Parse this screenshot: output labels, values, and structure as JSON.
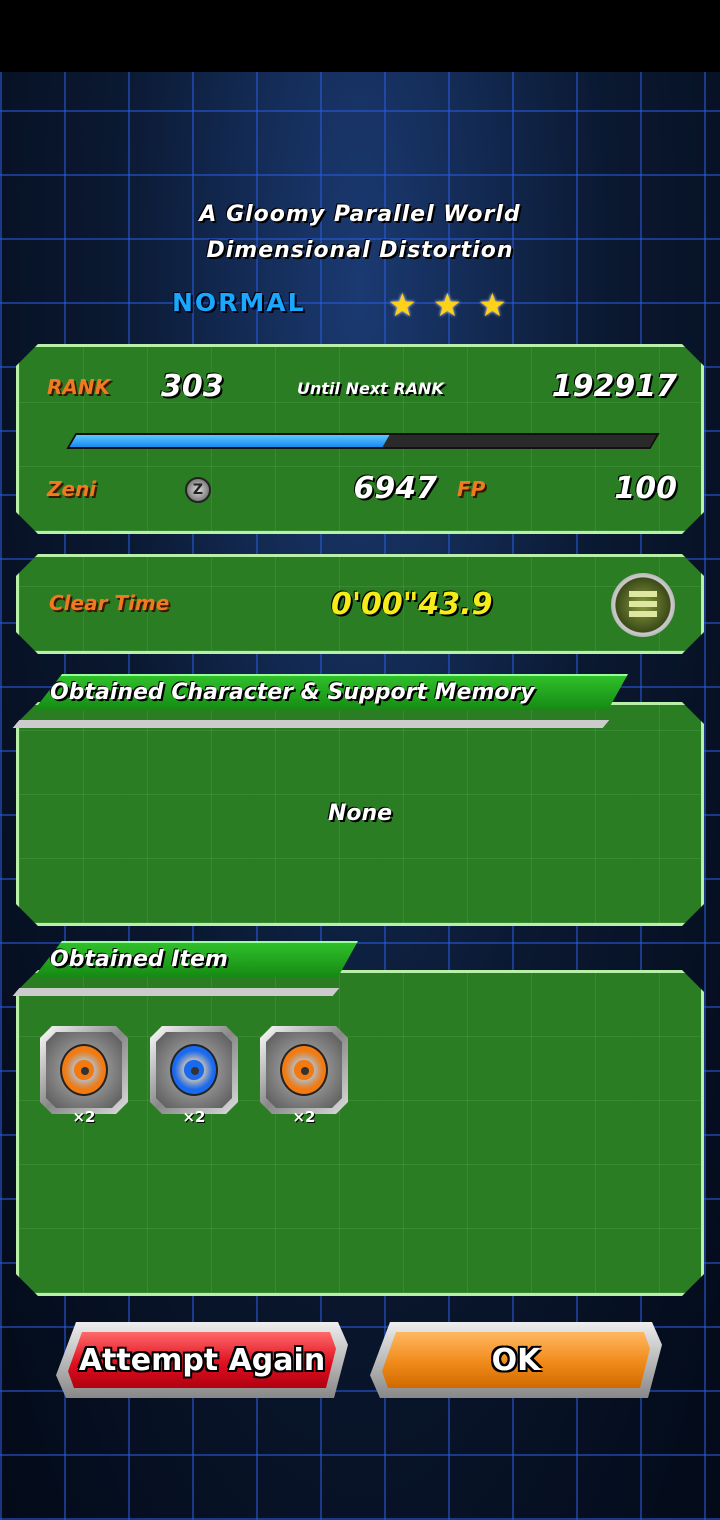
{
  "stage": {
    "title_line1": "A Gloomy Parallel World",
    "title_line2": "Dimensional Distortion",
    "difficulty": "NORMAL",
    "stars": 3
  },
  "rank": {
    "label": "RANK",
    "value": "303",
    "until_label": "Until Next RANK",
    "until_value": "192917",
    "progress_percent": 54
  },
  "rewards": {
    "zeni_label": "Zeni",
    "zeni_value": "6947",
    "fp_label": "FP",
    "fp_value": "100"
  },
  "clear": {
    "label": "Clear Time",
    "value": "0'00\"43.9"
  },
  "characters": {
    "header": "Obtained Character & Support Memory",
    "empty_text": "None"
  },
  "items": {
    "header": "Obtained Item",
    "list": [
      {
        "icon": "orange-film-reel",
        "qty": "×2",
        "color": "#f27a10"
      },
      {
        "icon": "blue-film-reel",
        "qty": "×2",
        "color": "#1a6af0"
      },
      {
        "icon": "orange-film-reel",
        "qty": "×2",
        "color": "#f27a10"
      }
    ]
  },
  "buttons": {
    "attempt_again": "Attempt Again",
    "ok": "OK"
  },
  "colors": {
    "panel": "#2a7d22",
    "accent_label": "#f07a20",
    "time": "#f5ec1a",
    "difficulty": "#1aa8ff"
  }
}
